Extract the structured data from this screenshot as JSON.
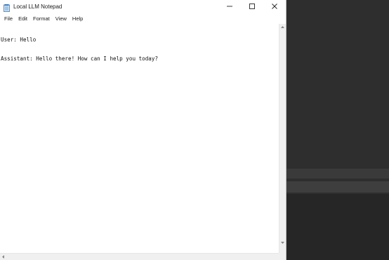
{
  "window": {
    "title": "Local LLM Notepad",
    "icon": "notepad-icon"
  },
  "caption": {
    "minimize_icon": "minimize-icon",
    "maximize_icon": "maximize-icon",
    "close_icon": "close-icon"
  },
  "menu": {
    "items": [
      {
        "label": "File"
      },
      {
        "label": "Edit"
      },
      {
        "label": "Format"
      },
      {
        "label": "View"
      },
      {
        "label": "Help"
      }
    ]
  },
  "editor": {
    "lines": [
      "User: Hello",
      "Assistant: Hello there! How can I help you today?"
    ]
  },
  "colors": {
    "window_bg": "#ffffff",
    "desktop_bg": "#2b2b2b",
    "text": "#111111"
  }
}
